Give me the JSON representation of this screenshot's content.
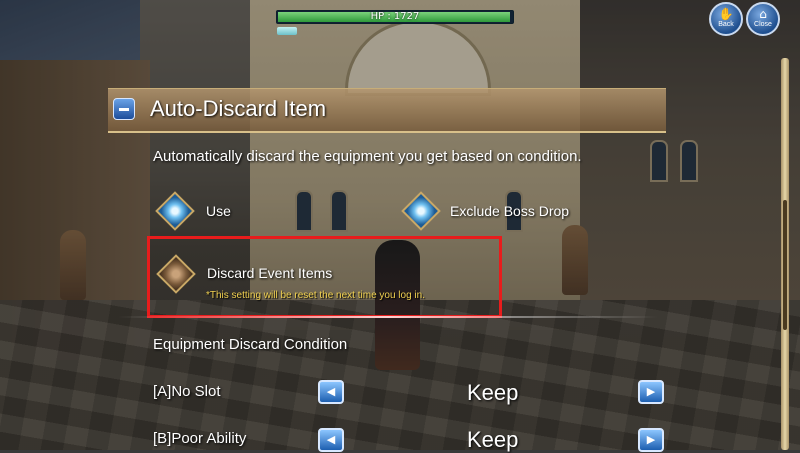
{
  "hud": {
    "hp_text": "HP : 1727",
    "hp_fraction": 0.99,
    "mp_fraction": 0.1
  },
  "top_buttons": {
    "back_label": "Back",
    "close_label": "Close"
  },
  "panel": {
    "title": "Auto-Discard Item",
    "description": "Automatically discard the equipment you get based on condition.",
    "options": [
      {
        "label": "Use",
        "checked": true
      },
      {
        "label": "Exclude Boss Drop",
        "checked": true
      },
      {
        "label": "Discard Event Items",
        "checked": false
      }
    ],
    "event_note": "*This setting will be reset the next time you log in.",
    "section_title": "Equipment Discard Condition",
    "conditions": [
      {
        "label": "[A]No Slot",
        "value": "Keep"
      },
      {
        "label": "[B]Poor Ability",
        "value": "Keep"
      }
    ]
  },
  "icons": {
    "collapse": "minus-icon",
    "left": "arrow-left-icon",
    "right": "arrow-right-icon",
    "checkbox_on": "diamond-checked-icon",
    "checkbox_off": "diamond-unchecked-icon"
  },
  "colors": {
    "highlight": "#e81c1c",
    "note": "#f0d050",
    "hp_bar": "#2e9a3a",
    "button_blue": "#1d5fb0"
  }
}
